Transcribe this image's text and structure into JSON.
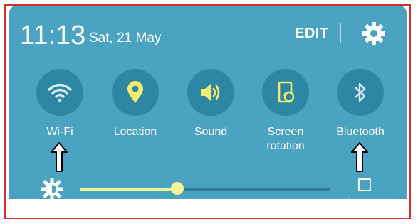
{
  "status": {
    "time": "11:13",
    "date": "Sat, 21 May",
    "edit_label": "EDIT"
  },
  "quick_settings": [
    {
      "label": "Wi-Fi",
      "icon": "wifi-icon"
    },
    {
      "label": "Location",
      "icon": "location-icon"
    },
    {
      "label": "Sound",
      "icon": "sound-icon"
    },
    {
      "label": "Screen\nrotation",
      "icon": "screen-rotation-icon"
    },
    {
      "label": "Bluetooth",
      "icon": "bluetooth-icon"
    }
  ],
  "brightness": {
    "level": 0.39,
    "outdoor_label": "Outdoor",
    "outdoor_checked": false
  },
  "colors": {
    "panel": "#4aa3c1",
    "tile": "#2d86a4",
    "icon_active": "#f5ee6b",
    "slider": "#f4f39a",
    "frame_border": "#d32f2f"
  }
}
